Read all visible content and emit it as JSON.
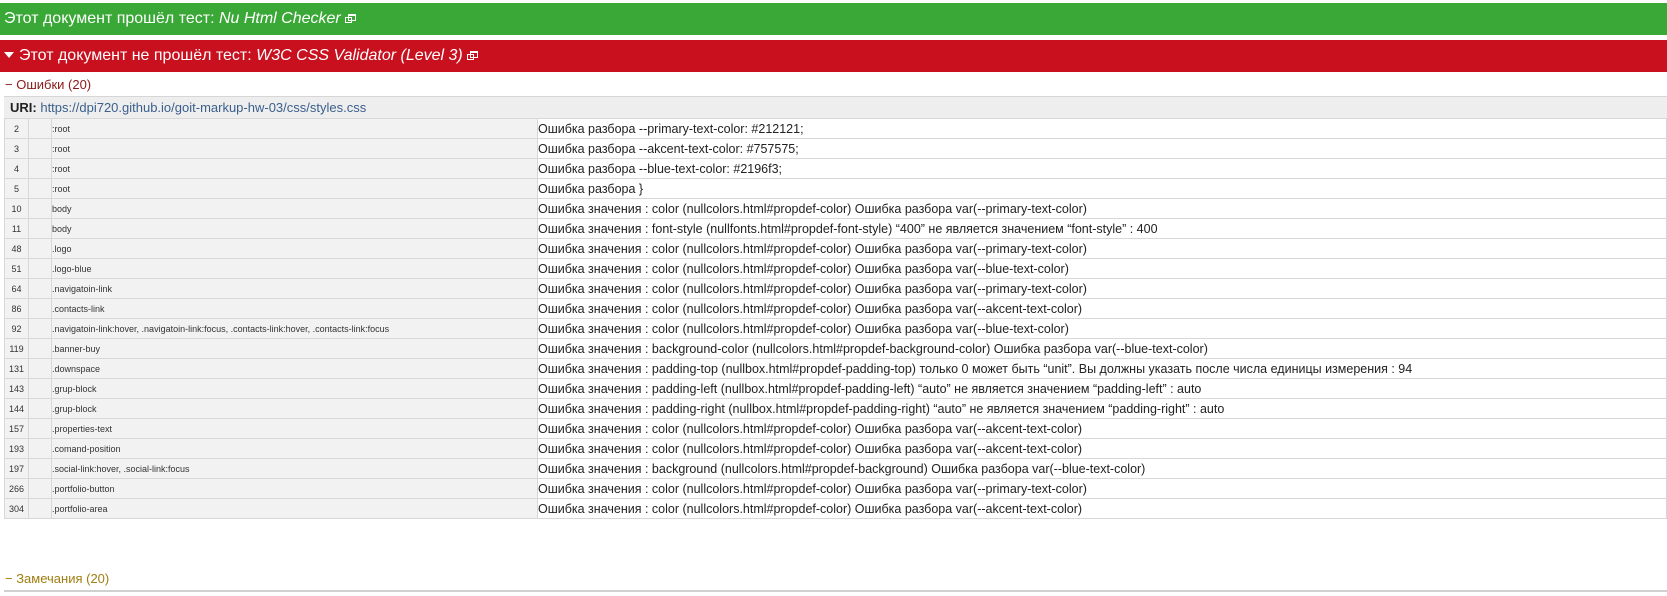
{
  "pass_banner": {
    "text": "Этот документ прошёл тест: ",
    "tool": "Nu Html Checker"
  },
  "fail_banner": {
    "text": "Этот документ не прошёл тест: ",
    "tool": "W3C CSS Validator (Level 3)"
  },
  "errors_toggle": "− Ошибки (20)",
  "uri": {
    "label": "URI:",
    "value": "https://dpi720.github.io/goit-markup-hw-03/css/styles.css"
  },
  "rows": [
    {
      "line": "2",
      "context": ":root",
      "message": "Ошибка разбора --primary-text-color: #212121;"
    },
    {
      "line": "3",
      "context": ":root",
      "message": "Ошибка разбора --akcent-text-color: #757575;"
    },
    {
      "line": "4",
      "context": ":root",
      "message": "Ошибка разбора --blue-text-color: #2196f3;"
    },
    {
      "line": "5",
      "context": ":root",
      "message": "Ошибка разбора }"
    },
    {
      "line": "10",
      "context": "body",
      "message": "Ошибка значения : color (nullcolors.html#propdef-color) Ошибка разбора var(--primary-text-color)"
    },
    {
      "line": "11",
      "context": "body",
      "message": "Ошибка значения : font-style (nullfonts.html#propdef-font-style) “400” не является значением “font-style” : 400"
    },
    {
      "line": "48",
      "context": ".logo",
      "message": "Ошибка значения : color (nullcolors.html#propdef-color) Ошибка разбора var(--primary-text-color)"
    },
    {
      "line": "51",
      "context": ".logo-blue",
      "message": "Ошибка значения : color (nullcolors.html#propdef-color) Ошибка разбора var(--blue-text-color)"
    },
    {
      "line": "64",
      "context": ".navigatoin-link",
      "message": "Ошибка значения : color (nullcolors.html#propdef-color) Ошибка разбора var(--primary-text-color)"
    },
    {
      "line": "86",
      "context": ".contacts-link",
      "message": "Ошибка значения : color (nullcolors.html#propdef-color) Ошибка разбора var(--akcent-text-color)"
    },
    {
      "line": "92",
      "context": ".navigatoin-link:hover, .navigatoin-link:focus, .contacts-link:hover, .contacts-link:focus",
      "message": "Ошибка значения : color (nullcolors.html#propdef-color) Ошибка разбора var(--blue-text-color)"
    },
    {
      "line": "119",
      "context": ".banner-buy",
      "message": "Ошибка значения : background-color (nullcolors.html#propdef-background-color) Ошибка разбора var(--blue-text-color)"
    },
    {
      "line": "131",
      "context": ".downspace",
      "message": "Ошибка значения : padding-top (nullbox.html#propdef-padding-top) только 0 может быть “unit”. Вы должны указать после числа единицы измерения : 94"
    },
    {
      "line": "143",
      "context": ".grup-block",
      "message": "Ошибка значения : padding-left (nullbox.html#propdef-padding-left) “auto” не является значением “padding-left” : auto"
    },
    {
      "line": "144",
      "context": ".grup-block",
      "message": "Ошибка значения : padding-right (nullbox.html#propdef-padding-right) “auto” не является значением “padding-right” : auto"
    },
    {
      "line": "157",
      "context": ".properties-text",
      "message": "Ошибка значения : color (nullcolors.html#propdef-color) Ошибка разбора var(--akcent-text-color)"
    },
    {
      "line": "193",
      "context": ".comand-position",
      "message": "Ошибка значения : color (nullcolors.html#propdef-color) Ошибка разбора var(--akcent-text-color)"
    },
    {
      "line": "197",
      "context": ".social-link:hover, .social-link:focus",
      "message": "Ошибка значения : background (nullcolors.html#propdef-background) Ошибка разбора var(--blue-text-color)"
    },
    {
      "line": "266",
      "context": ".portfolio-button",
      "message": "Ошибка значения : color (nullcolors.html#propdef-color) Ошибка разбора var(--primary-text-color)"
    },
    {
      "line": "304",
      "context": ".portfolio-area",
      "message": "Ошибка значения : color (nullcolors.html#propdef-color) Ошибка разбора var(--akcent-text-color)"
    }
  ],
  "warnings_toggle": "− Замечания (20)",
  "colors": {
    "pass": "#3aa836",
    "fail": "#c8101e",
    "errors_text": "#8b1a1a",
    "warnings_text": "#a07d10",
    "link": "#3a5f8c"
  },
  "icons": {
    "external": "external-link-icon",
    "caret": "caret-down-icon"
  }
}
